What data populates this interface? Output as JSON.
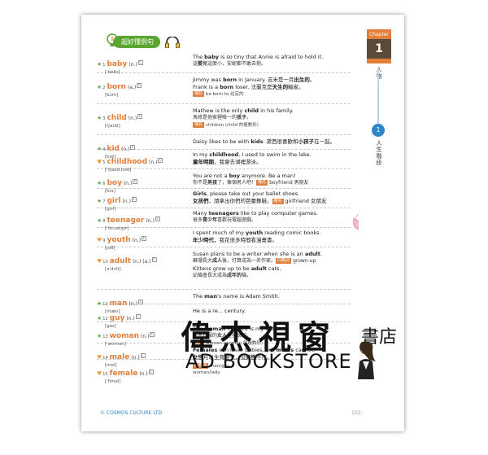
{
  "header": {
    "title": "超好懂例句"
  },
  "chapter": {
    "label": "Chapter",
    "number": "1",
    "name": "人物"
  },
  "section": {
    "number": "1",
    "name": "人生階段"
  },
  "entries": [
    {
      "mark": "star",
      "num": "1",
      "word": "baby",
      "pos": "(n.)",
      "phon": "[ˈbebɪ]",
      "lines": [
        "The <b>baby</b> is so tiny that Annie is afraid to hold it.",
        "這<b>嬰兒</b>這麼小，安妮都不敢去抱。"
      ],
      "tag": "",
      "tip": ""
    },
    {
      "mark": "star",
      "num": "2",
      "word": "born",
      "pos": "(a.)",
      "phon": "[bɔrn]",
      "lines": [
        "Jimmy was <b>born</b> in January. 吉米是一月<b>出生的</b>。",
        "Frank is a <b>born</b> loser. 法蘭克是<b>天生的</b>輸家。"
      ],
      "tag": "補充",
      "tip": "be born to 註定的"
    },
    {
      "mark": "star",
      "num": "3",
      "word": "child",
      "pos": "(n.)",
      "phon": "[tʃaɪld]",
      "lines": [
        "Mathew is the only <b>child</b> in his family.",
        "馬修是他家裡唯一的<b>孩子</b>。"
      ],
      "tag": "補充",
      "tip": "children (child 的複數形)"
    },
    {
      "mark": "star",
      "num": "4",
      "word": "kid",
      "pos": "(n.)",
      "phon": "[kɪd]",
      "lines": [
        "Daisy likes to be with <b>kids</b>. 黛西很喜歡和<b>小孩子</b>在一起。"
      ],
      "tag": "",
      "tip": ""
    },
    {
      "mark": "heart",
      "num": "5",
      "word": "childhood",
      "pos": "(n.)",
      "phon": "[ˈtʃaɪld,hʊd]",
      "lines": [
        "In my <b>childhood</b>, I used to swim in the lake.",
        "<b>童年時期</b>，我會去湖裡游泳。"
      ],
      "tag": "",
      "tip": ""
    },
    {
      "mark": "star",
      "num": "6",
      "word": "boy",
      "pos": "(n.)",
      "phon": "[bɔɪ]",
      "lines": [
        "You are not a <b>boy</b> anymore. Be a man!",
        "你不是<b>男孩</b>了，像個男人吧！<span class=\"tag\">補充</span>boyfriend 男朋友"
      ],
      "tag": "",
      "tip": ""
    },
    {
      "mark": "star",
      "num": "7",
      "word": "girl",
      "pos": "(n.)",
      "phon": "[gɝl]",
      "lines": [
        "<b>Girls</b>, please take out your ballet shoes.",
        "<b>女孩們</b>，請拿出你們的芭蕾舞鞋。<span class=\"tag\">補充</span>girlfriend 女朋友"
      ],
      "tag": "",
      "tip": ""
    },
    {
      "mark": "star",
      "num": "8",
      "word": "teenager",
      "pos": "(n.)",
      "phon": "[ˈtin,edʒɚ]",
      "lines": [
        "Many <b>teenagers</b> like to play computer games.",
        "很多<b>青少年</b>喜歡玩電腦遊戲。"
      ],
      "tag": "",
      "tip": ""
    },
    {
      "mark": "heart",
      "num": "9",
      "word": "youth",
      "pos": "(n.)",
      "phon": "[juθ]",
      "lines": [
        "I spent much of my <b>youth</b> reading comic books.",
        "<b>年少時代</b>，我花很多時間看漫畫書。"
      ],
      "tag": "",
      "tip": ""
    },
    {
      "mark": "heart",
      "num": "10",
      "word": "adult",
      "pos": "(n.) (a.)",
      "phon": "[əˈdʌlt]",
      "lines": [
        "Susan plans to be a writer when she is an <b>adult</b>.",
        "蘇珊長大<b>成人</b>後，打算成為一名作家。<span class=\"tag\">同義詞</span>grown-up",
        "Kittens grow up to be <b>adult</b> cats.",
        "幼貓會長大成為<b>成年的</b>貓。"
      ],
      "tag": "",
      "tip": ""
    },
    {
      "mark": "star",
      "num": "11",
      "word": "man",
      "pos": "(n.)",
      "phon": "[mæn]",
      "lines": [
        "The <b>man</b>'s name is Adam Smith."
      ],
      "tag": "",
      "tip": ""
    },
    {
      "mark": "star",
      "num": "12",
      "word": "guy",
      "pos": "(n.)",
      "phon": "[gaɪ]",
      "lines": [
        "He is a re... century."
      ],
      "tag": "",
      "tip": ""
    },
    {
      "mark": "star",
      "num": "13",
      "word": "woman",
      "pos": "(n.)",
      "phon": "[ˈwʊmən]",
      "lines": [
        "The <b>woman</b> in black is my sister.",
        "穿黑衣服的<b>女人</b>是我姊姊。"
      ],
      "tag": "補充",
      "tip": "women (woman 的複數形)"
    },
    {
      "mark": "heart",
      "num": "14",
      "word": "male",
      "pos": "(n.)",
      "phon": "[mel]",
      "lines": [
        "<b>Females</b> can have babies, but <b>males</b> cannot.",
        "<b>女性</b>可以生育嬰兒，但<b>男性</b>不行。"
      ],
      "tag": "",
      "tip": ""
    },
    {
      "mark": "heart",
      "num": "15",
      "word": "female",
      "pos": "(n.)",
      "phon": "[ˈfimel]",
      "lines": [],
      "tag": "同義詞",
      "tip": "man/guy\nwoman/lady"
    }
  ],
  "footer": {
    "copyright": "© COSMOS CULTURE LTD",
    "page": "102"
  },
  "watermark": {
    "cn": "偉杰視窗",
    "cn_small": "書店",
    "en": "AD BOOKSTORE"
  },
  "colors": {
    "accent": "#e07f3c",
    "green": "#5aa532",
    "blue": "#2f86c8"
  }
}
